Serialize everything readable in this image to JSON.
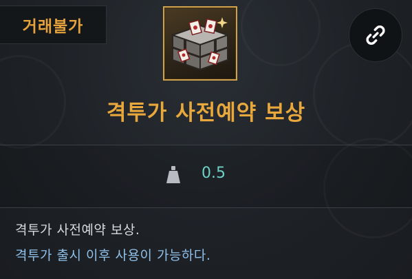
{
  "item": {
    "trade_status": "거래불가",
    "name": "격투가 사전예약 보상",
    "icon": "treasure-chest-icon",
    "weight": "0.5",
    "description_lines": [
      "격투가 사전예약 보상.",
      "격투가 출시 이후 사용이 가능하다."
    ]
  },
  "actions": {
    "link_icon": "link-icon"
  },
  "colors": {
    "title": "#e9a83c",
    "trade_status": "#e6a23c",
    "weight_value": "#6fd0c5",
    "description_primary": "#d7dadd",
    "description_secondary": "#8fc0ea",
    "icon_border": "#d2a24a"
  }
}
